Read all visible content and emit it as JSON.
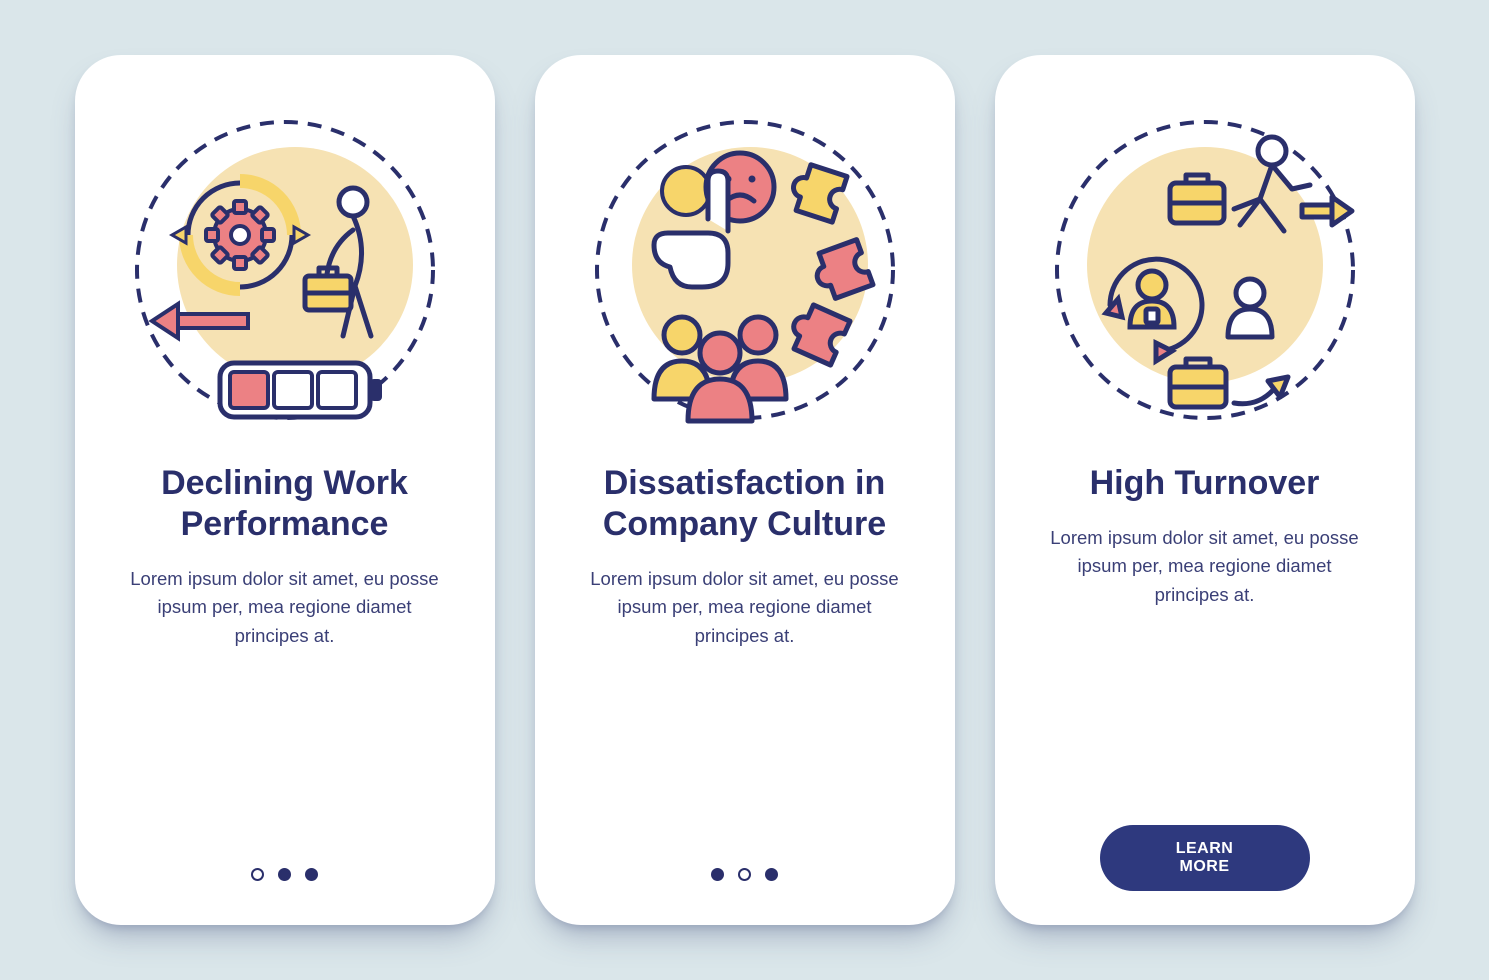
{
  "colors": {
    "background": "#dae6ea",
    "card": "#ffffff",
    "stroke": "#2a2f6b",
    "coral": "#ec8184",
    "yellow": "#f7d56a",
    "cream": "#f6e2b3",
    "accent": "#2e397e"
  },
  "cards": [
    {
      "icon": "declining-performance-icon",
      "title": "Declining Work Performance",
      "body": "Lorem ipsum dolor sit amet, eu posse ipsum per, mea regione diamet principes at.",
      "pager": {
        "count": 3,
        "active": 0
      },
      "cta": null
    },
    {
      "icon": "dissatisfaction-culture-icon",
      "title": "Dissatisfaction in Company Culture",
      "body": "Lorem ipsum dolor sit amet, eu posse ipsum per, mea regione diamet principes at.",
      "pager": {
        "count": 3,
        "active": 1
      },
      "cta": null
    },
    {
      "icon": "high-turnover-icon",
      "title": "High Turnover",
      "body": "Lorem ipsum dolor sit amet, eu posse ipsum per, mea regione diamet principes at.",
      "pager": null,
      "cta": "LEARN MORE"
    }
  ]
}
